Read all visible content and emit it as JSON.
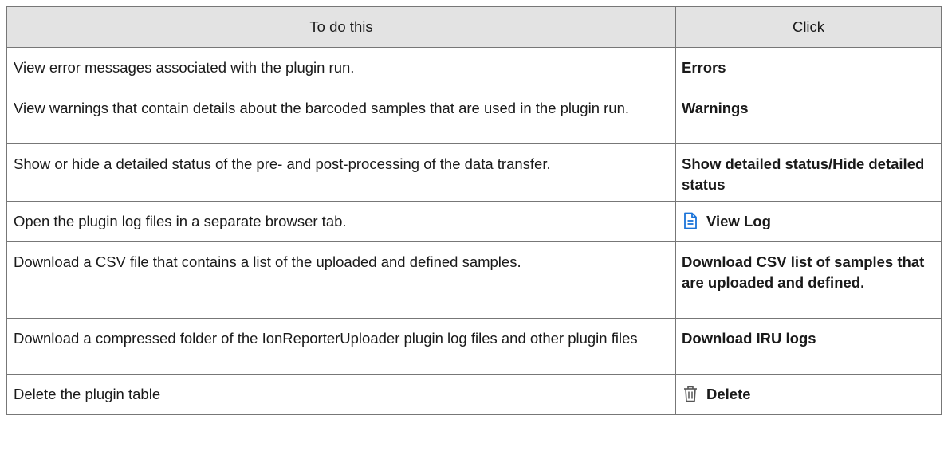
{
  "table": {
    "headers": [
      "To do this",
      "Click"
    ],
    "rows": [
      {
        "description": "View error messages associated with the plugin run.",
        "click": "Errors"
      },
      {
        "description": "View warnings that contain details about the barcoded samples that are used in the plugin run.",
        "click": "Warnings"
      },
      {
        "description": "Show or hide a detailed status of the pre- and post-processing of the data transfer.",
        "click": "Show detailed status/Hide detailed status"
      },
      {
        "description": "Open the plugin log files in a separate browser tab.",
        "click": "View Log",
        "icon": "document-icon"
      },
      {
        "description": "Download a CSV file that contains a list of the uploaded and defined samples.",
        "click": "Download CSV list of samples that are uploaded and defined."
      },
      {
        "description": "Download a compressed folder of the IonReporterUploader plugin log files and other plugin files",
        "click": "Download IRU logs"
      },
      {
        "description": "Delete the plugin table",
        "click": "Delete",
        "icon": "trash-icon"
      }
    ]
  },
  "colors": {
    "header_bg": "#e3e3e3",
    "border": "#777777",
    "icon_blue": "#1a73d9",
    "icon_gray": "#555555"
  }
}
